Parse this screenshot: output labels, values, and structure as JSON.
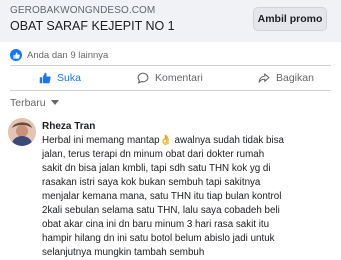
{
  "ad": {
    "domain": "GEROBAKWONGNDESO.COM",
    "title": "OBAT SARAF KEJEPIT NO 1",
    "button_label": "Ambil promo"
  },
  "reactions": {
    "summary": "Anda dan 9 lainnya"
  },
  "actions": {
    "like_label": "Suka",
    "comment_label": "Komentari",
    "share_label": "Bagikan"
  },
  "sort": {
    "label": "Terbaru"
  },
  "comment": {
    "author": "Rheza Tran",
    "lines": [
      "Herbal ini memang mantap👌 awalnya sudah tidak bisa",
      "jalan, terus terapi dn minum obat dari dokter rumah",
      "sakit dn bisa jalan kmbli, tapi sdh satu THN kok yg di",
      "rasakan istri saya kok bukan sembuh tapi sakitnya",
      "menjalar kemana mana, satu THN itu tiap bulan kontrol",
      "2kali sebulan selama satu THN, lalu saya cobadeh beli",
      "obat akar cina ini dn baru minum 3 hari rasa sakit itu",
      "hampir hilang dn ini satu botol belum abislo jadi untuk",
      "selanjutnya mungkin tambah sembuh"
    ]
  },
  "colors": {
    "accent": "#1877f2",
    "muted": "#65676b",
    "ad_bg": "#f0f2f5"
  }
}
